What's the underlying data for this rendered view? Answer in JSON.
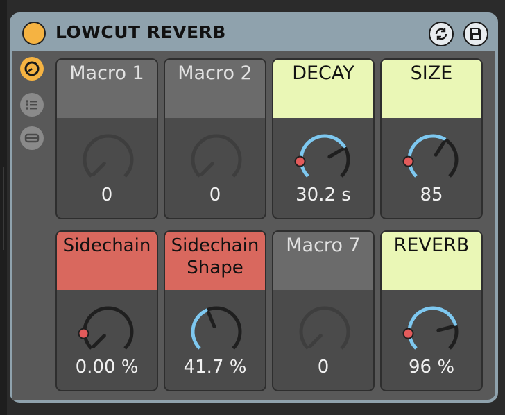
{
  "device": {
    "title": "LOWCUT REVERB",
    "power_color": "#f5b342",
    "header_buttons": [
      "sync-icon",
      "save-icon"
    ]
  },
  "sidebar": {
    "icons": [
      "macro-map-icon",
      "list-icon",
      "minimize-icon"
    ]
  },
  "macros": [
    {
      "name": "Macro 1",
      "value": "0",
      "color": "gray",
      "level": 0.0,
      "mapped": false
    },
    {
      "name": "Macro 2",
      "value": "0",
      "color": "gray",
      "level": 0.0,
      "mapped": false
    },
    {
      "name": "DECAY",
      "value": "30.2 s",
      "color": "yellow",
      "level": 0.72,
      "mapped": true
    },
    {
      "name": "SIZE",
      "value": "85",
      "color": "yellow",
      "level": 0.62,
      "mapped": true
    },
    {
      "name": "Sidechain",
      "value": "0.00 %",
      "color": "red",
      "level": 0.0,
      "mapped": true
    },
    {
      "name": "Sidechain Shape",
      "value": "41.7 %",
      "color": "red",
      "level": 0.417,
      "mapped": false
    },
    {
      "name": "Macro 7",
      "value": "0",
      "color": "gray",
      "level": 0.0,
      "mapped": false
    },
    {
      "name": "REVERB",
      "value": "96 %",
      "color": "yellow",
      "level": 0.78,
      "mapped": true
    }
  ],
  "colors": {
    "accent_blue": "#7ec8f0",
    "mapped_dot": "#e35b5b",
    "device_frame": "#8fa2ad"
  }
}
